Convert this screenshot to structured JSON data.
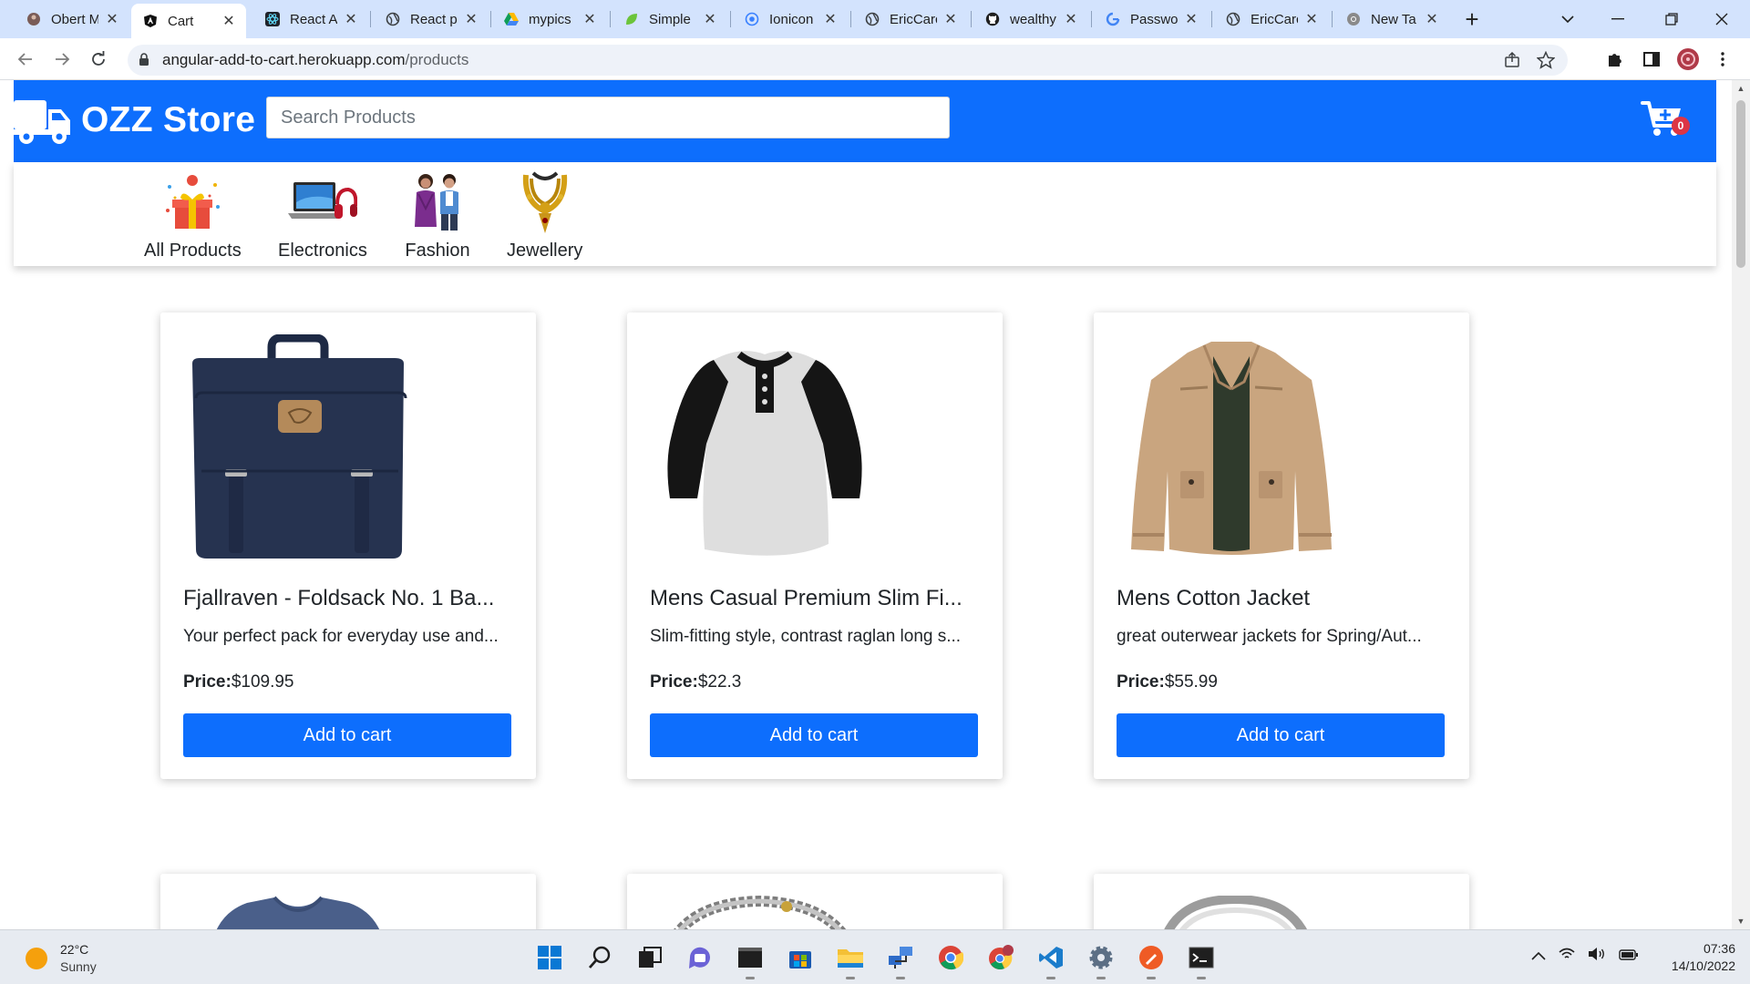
{
  "browser": {
    "tabs": [
      {
        "label": "Obert M",
        "icon": "globe-icon"
      },
      {
        "label": "Cart",
        "icon": "angular-icon",
        "active": true
      },
      {
        "label": "React A",
        "icon": "react-icon"
      },
      {
        "label": "React p",
        "icon": "globe-icon"
      },
      {
        "label": "mypics",
        "icon": "google-drive-icon"
      },
      {
        "label": "Simple",
        "icon": "leaf-icon"
      },
      {
        "label": "Ionicon",
        "icon": "ionicons-icon"
      },
      {
        "label": "EricCarc",
        "icon": "globe-icon"
      },
      {
        "label": "wealthy",
        "icon": "github-icon"
      },
      {
        "label": "Passwor",
        "icon": "google-icon"
      },
      {
        "label": "EricCarc",
        "icon": "globe-icon"
      },
      {
        "label": "New Ta",
        "icon": "chrome-icon"
      }
    ],
    "address": {
      "host": "angular-add-to-cart.herokuapp.com",
      "path": "/products"
    }
  },
  "store": {
    "brand": "OZZ Store",
    "search_placeholder": "Search Products",
    "cart_count": "0",
    "colors": {
      "primary": "#0d6efd",
      "badge": "#dc3545"
    }
  },
  "categories": [
    {
      "label": "All Products",
      "icon": "gift-box-icon"
    },
    {
      "label": "Electronics",
      "icon": "laptop-headphones-icon"
    },
    {
      "label": "Fashion",
      "icon": "fashion-models-icon"
    },
    {
      "label": "Jewellery",
      "icon": "gold-necklace-icon"
    }
  ],
  "products": [
    {
      "title": "Fjallraven - Foldsack No. 1 Ba...",
      "desc": "Your perfect pack for everyday use and...",
      "price_label": "Price:",
      "price": "$109.95",
      "button": "Add to cart",
      "image": "backpack-image"
    },
    {
      "title": "Mens Casual Premium Slim Fi...",
      "desc": "Slim-fitting style, contrast raglan long s...",
      "price_label": "Price:",
      "price": "$22.3",
      "button": "Add to cart",
      "image": "raglan-shirt-image"
    },
    {
      "title": "Mens Cotton Jacket",
      "desc": "great outerwear jackets for Spring/Aut...",
      "price_label": "Price:",
      "price": "$55.99",
      "button": "Add to cart",
      "image": "cotton-jacket-image"
    }
  ],
  "partial_products": [
    {
      "image": "blue-tshirt-image"
    },
    {
      "image": "silver-bracelet-image"
    },
    {
      "image": "silver-ring-image"
    }
  ],
  "taskbar": {
    "weather": {
      "temp": "22°C",
      "condition": "Sunny"
    },
    "clock": {
      "time": "07:36",
      "date": "14/10/2022"
    }
  }
}
